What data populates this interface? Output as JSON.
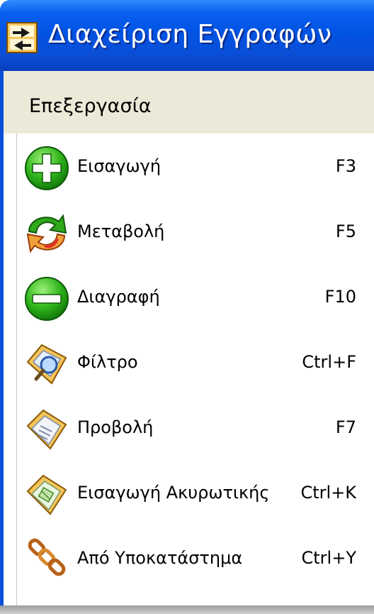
{
  "window": {
    "title": "Διαχείριση Εγγραφών",
    "icon": "record-manager-icon"
  },
  "menubar": {
    "title": "Επεξεργασία"
  },
  "menu": {
    "items": [
      {
        "label": "Εισαγωγή",
        "shortcut": "F3",
        "icon": "add-green-plus-icon"
      },
      {
        "label": "Μεταβολή",
        "shortcut": "F5",
        "icon": "refresh-arrows-icon"
      },
      {
        "label": "Διαγραφή",
        "shortcut": "F10",
        "icon": "delete-green-minus-icon"
      },
      {
        "label": "Φίλτρο",
        "shortcut": "Ctrl+F",
        "icon": "filter-magnifier-icon"
      },
      {
        "label": "Προβολή",
        "shortcut": "F7",
        "icon": "view-document-icon"
      },
      {
        "label": "Εισαγωγή Ακυρωτικής",
        "shortcut": "Ctrl+K",
        "icon": "cancel-entry-document-icon"
      },
      {
        "label": "Από Υποκατάστημα",
        "shortcut": "Ctrl+Y",
        "icon": "branch-link-icon"
      }
    ]
  },
  "colors": {
    "titlebar": "#0054e3",
    "menubar": "#ece9d8",
    "text": "#000000"
  }
}
